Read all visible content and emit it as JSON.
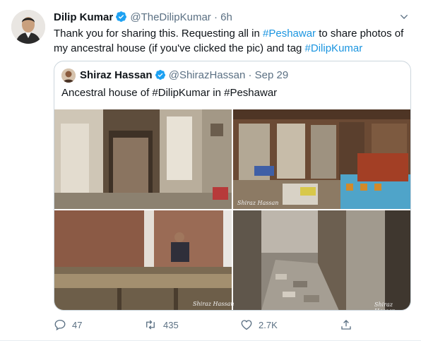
{
  "tweet": {
    "name": "Dilip Kumar",
    "handle": "@TheDilipKumar",
    "separator": "·",
    "time": "6h",
    "text_parts": [
      {
        "t": "Thank you for sharing this. Requesting all in ",
        "tag": false
      },
      {
        "t": "#Peshawar",
        "tag": true
      },
      {
        "t": " to share photos of my ancestral house (if you've clicked the pic) and tag ",
        "tag": false
      },
      {
        "t": "#DilipKumar",
        "tag": true
      }
    ]
  },
  "quote": {
    "name": "Shiraz Hassan",
    "handle": "@ShirazHassan",
    "separator": "·",
    "time": "Sep 29",
    "text": "Ancestral house of #DilipKumar in #Peshawar",
    "watermarks": [
      "Shiraz Hassan",
      "Shiraz Hassan",
      "Shiraz Hassan"
    ]
  },
  "actions": {
    "replies": "47",
    "retweets": "435",
    "likes": "2.7K"
  },
  "colors": {
    "accent": "#1b95e0",
    "muted": "#5b7083",
    "border": "#ccd6dd",
    "verified": "#1da1f2"
  },
  "icons": [
    "verified-badge-icon",
    "chevron-down-icon",
    "reply-icon",
    "retweet-icon",
    "like-icon",
    "share-icon"
  ]
}
